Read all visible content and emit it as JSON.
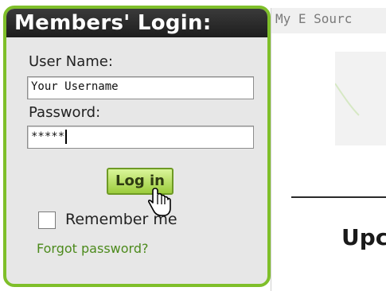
{
  "login": {
    "title": "Members' Login:",
    "username_label": "User Name:",
    "username_value": "Your Username",
    "password_label": "Password:",
    "password_value": "*****",
    "login_button": "Log in",
    "remember_label": "Remember me",
    "forgot_link": "Forgot password?"
  },
  "right": {
    "tab_label": "My E Sourc",
    "heading_partial": "Upc"
  },
  "colors": {
    "accent_green": "#7fbf2a",
    "button_green": "#b6e05c",
    "link_green": "#4c8a1c",
    "header_dark": "#2a2a2a"
  },
  "icons": [
    "hand-cursor-icon"
  ]
}
